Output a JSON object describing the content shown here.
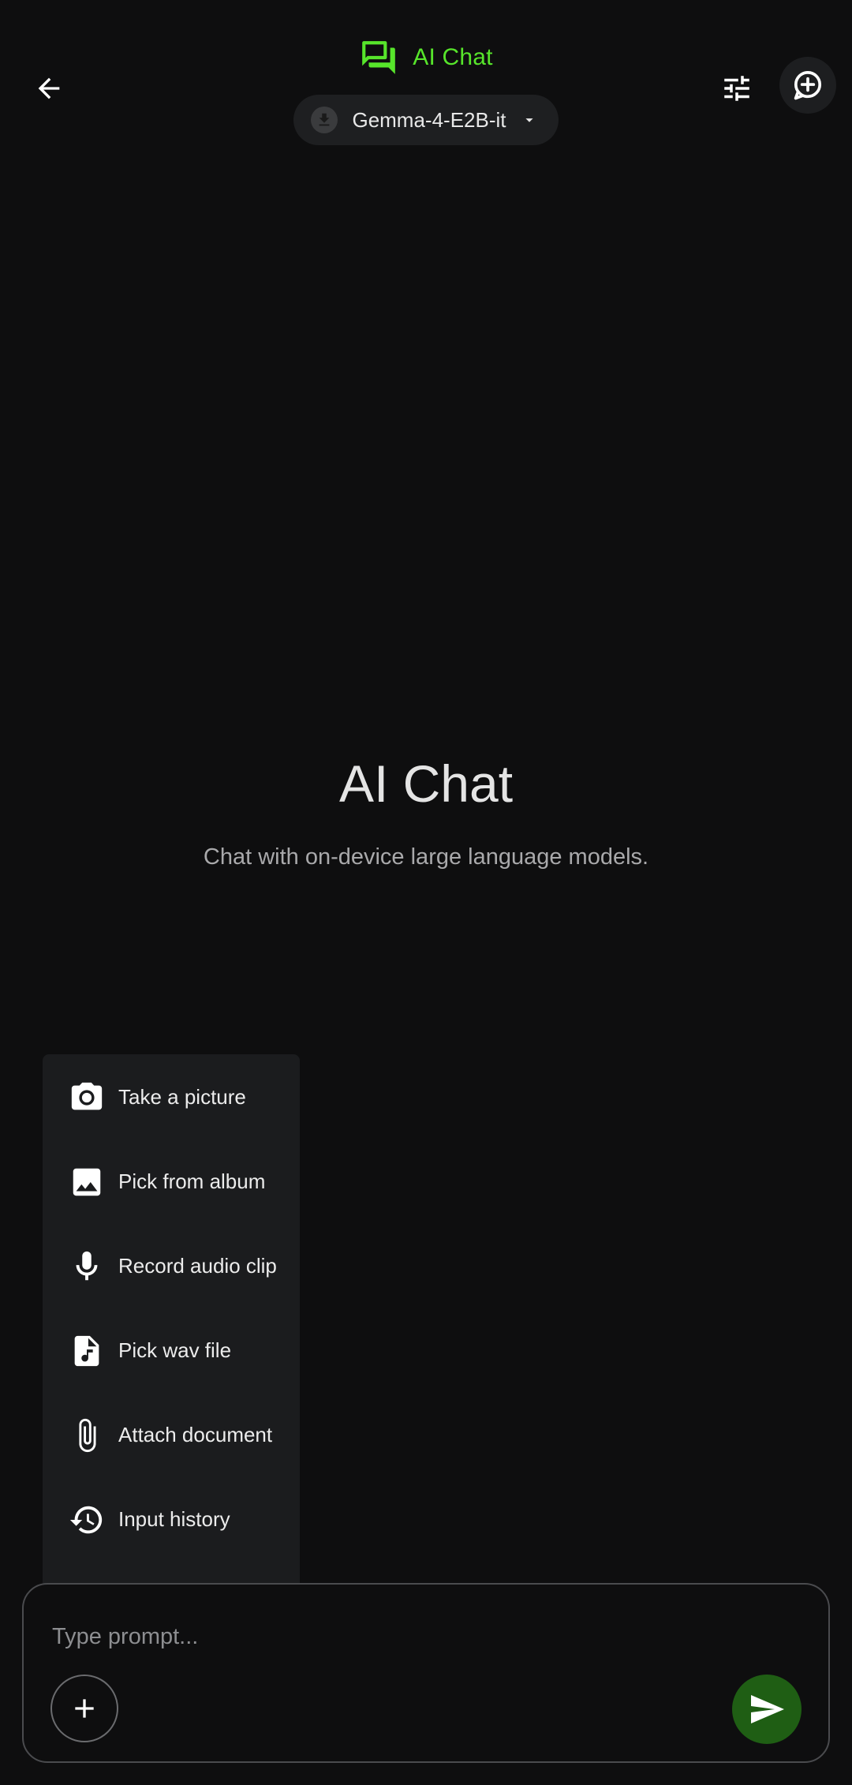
{
  "header": {
    "app_title": "AI Chat",
    "model_name": "Gemma-4-E2B-it",
    "accent_color": "#57e52b",
    "icons": {
      "back": "arrow-left-icon",
      "app": "forum-icon",
      "model_status": "download-icon",
      "dropdown": "caret-down-icon",
      "tune": "tune-icon",
      "new_chat": "add-comment-icon"
    }
  },
  "empty_state": {
    "title": "AI Chat",
    "subtitle": "Chat with on-device large language models."
  },
  "attach_menu": {
    "items": [
      {
        "label": "Take a picture",
        "icon": "camera-icon"
      },
      {
        "label": "Pick from album",
        "icon": "image-icon"
      },
      {
        "label": "Record audio clip",
        "icon": "microphone-icon"
      },
      {
        "label": "Pick wav file",
        "icon": "audio-file-icon"
      },
      {
        "label": "Attach document",
        "icon": "paperclip-icon"
      },
      {
        "label": "Input history",
        "icon": "history-icon"
      }
    ]
  },
  "composer": {
    "placeholder": "Type prompt...",
    "value": "",
    "send_color": "#1f5e14",
    "icons": {
      "add": "plus-icon",
      "send": "send-icon"
    }
  }
}
